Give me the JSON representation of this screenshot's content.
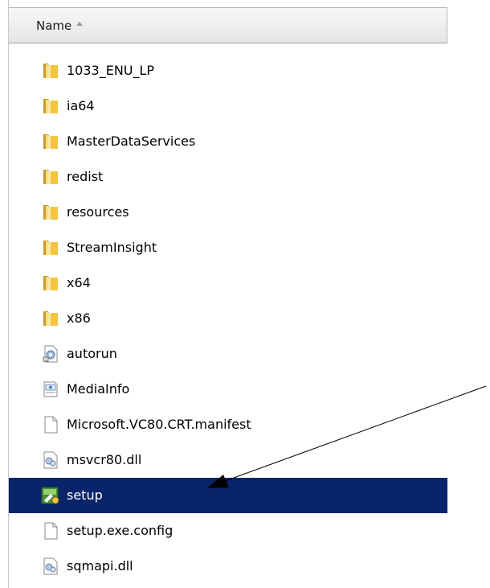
{
  "header": {
    "name_label": "Name",
    "sort_icon": "sort-ascending-icon"
  },
  "files": [
    {
      "name": "1033_ENU_LP",
      "icon": "folder-icon",
      "selected": false
    },
    {
      "name": "ia64",
      "icon": "folder-icon",
      "selected": false
    },
    {
      "name": "MasterDataServices",
      "icon": "folder-icon",
      "selected": false
    },
    {
      "name": "redist",
      "icon": "folder-icon",
      "selected": false
    },
    {
      "name": "resources",
      "icon": "folder-icon",
      "selected": false
    },
    {
      "name": "StreamInsight",
      "icon": "folder-icon",
      "selected": false
    },
    {
      "name": "x64",
      "icon": "folder-icon",
      "selected": false
    },
    {
      "name": "x86",
      "icon": "folder-icon",
      "selected": false
    },
    {
      "name": "autorun",
      "icon": "settings-file-icon",
      "selected": false
    },
    {
      "name": "MediaInfo",
      "icon": "xml-file-icon",
      "selected": false
    },
    {
      "name": "Microsoft.VC80.CRT.manifest",
      "icon": "blank-file-icon",
      "selected": false
    },
    {
      "name": "msvcr80.dll",
      "icon": "dll-file-icon",
      "selected": false
    },
    {
      "name": "setup",
      "icon": "setup-exe-icon",
      "selected": true
    },
    {
      "name": "setup.exe.config",
      "icon": "blank-file-icon",
      "selected": false
    },
    {
      "name": "sqmapi.dll",
      "icon": "dll-file-icon",
      "selected": false
    }
  ],
  "colors": {
    "selection": "#0a246a",
    "folder": "#f4c542",
    "arrow": "#000000"
  },
  "annotation": {
    "points_to": "setup"
  }
}
